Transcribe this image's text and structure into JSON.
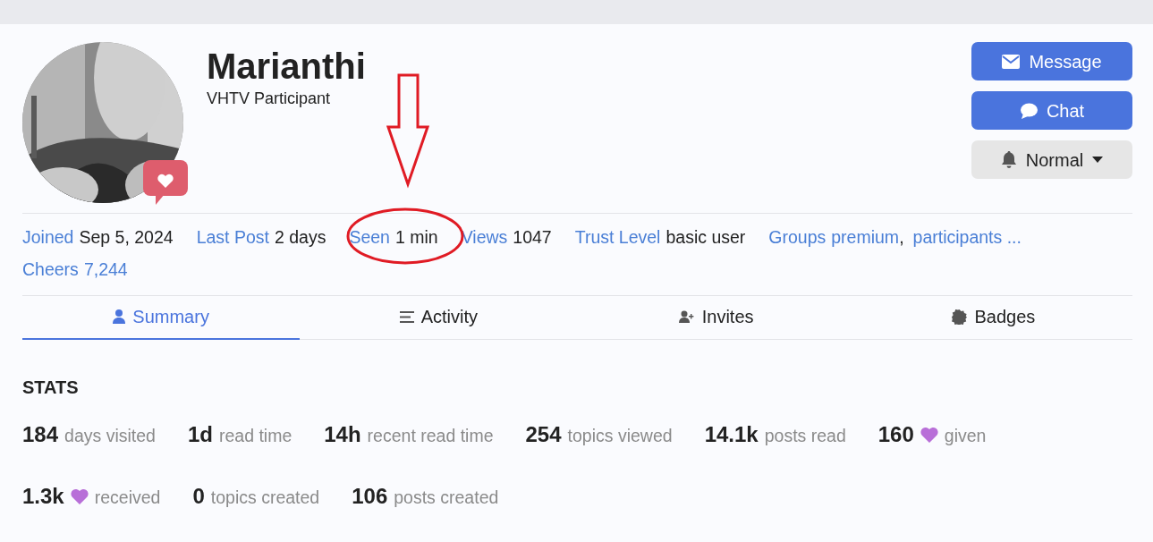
{
  "profile": {
    "name": "Marianthi",
    "title": "VHTV Participant",
    "badge": {
      "kind": "heart"
    }
  },
  "actions": [
    {
      "label": "Message",
      "kind": "primary"
    },
    {
      "label": "Chat",
      "kind": "primary"
    },
    {
      "label": "Normal",
      "kind": "dropdown"
    }
  ],
  "meta": [
    {
      "label": "Joined",
      "value": "Sep 5, 2024",
      "kind": "plain"
    },
    {
      "label": "Last Post",
      "value": "2 days",
      "kind": "plain"
    },
    {
      "label": "Seen",
      "value": "1 min",
      "kind": "plain"
    },
    {
      "label": "Views",
      "value": "1047",
      "kind": "plain"
    },
    {
      "label": "Trust Level",
      "value": "basic user",
      "kind": "plain"
    },
    {
      "label": "Groups",
      "links": [
        "premium",
        "participants ..."
      ],
      "separator": ","
    },
    {
      "label": "Cheers",
      "value": "7,244",
      "kind": "link"
    }
  ],
  "tabs": [
    {
      "label": "Summary",
      "selected": true
    },
    {
      "label": "Activity",
      "selected": false
    },
    {
      "label": "Invites",
      "selected": false
    },
    {
      "label": "Badges",
      "selected": false
    }
  ],
  "stats_heading": "STATS",
  "stats": [
    {
      "count": "184",
      "text": "days visited",
      "kind": "plain"
    },
    {
      "count": "1d",
      "text": "read time",
      "kind": "plain"
    },
    {
      "count": "14h",
      "text": "recent read time",
      "kind": "plain"
    },
    {
      "count": "254",
      "text": "topics viewed",
      "kind": "plain"
    },
    {
      "count": "14.1k",
      "text": "posts read",
      "kind": "plain"
    },
    {
      "count": "160",
      "text": "given",
      "kind": "heart"
    },
    {
      "count": "1.3k",
      "text": "received",
      "kind": "heart"
    },
    {
      "count": "0",
      "text": "topics created",
      "kind": "plain"
    },
    {
      "count": "106",
      "text": "posts created",
      "kind": "plain"
    }
  ]
}
